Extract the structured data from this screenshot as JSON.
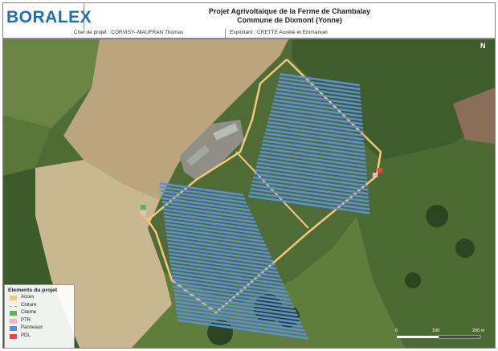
{
  "logo": {
    "text": "BORALEX"
  },
  "title": {
    "line1": "Projet Agrivoltaique de la Ferme de Chambalay",
    "line2": "Commune de Dixmont (Yonne)"
  },
  "info": {
    "chef_projet": "Chef de projet : CORVISY--MAUFRAN Thomas",
    "exploitant": "Exploitant : CRETTE Aurélie et  Emmanuel"
  },
  "legend": {
    "title": "Elements du projet",
    "items": [
      {
        "label": "Acces",
        "color": "#f4c77a",
        "style": "fill"
      },
      {
        "label": "Cloture",
        "color": "#66cc66",
        "style": "dash"
      },
      {
        "label": "Citerne",
        "color": "#59b84a",
        "style": "fill"
      },
      {
        "label": "PTR",
        "color": "#f2b6c6",
        "style": "fill"
      },
      {
        "label": "Panneaux",
        "color": "#5b8fd6",
        "style": "fill"
      },
      {
        "label": "PDL",
        "color": "#e8454d",
        "style": "fill"
      }
    ]
  },
  "north": {
    "symbol": "N"
  },
  "scale": {
    "labels": [
      "0",
      "100",
      "200 m"
    ]
  },
  "colors": {
    "field_light": "#c8b58c",
    "field_tan": "#b3a07a",
    "grass": "#4d6a34",
    "forest": "#2f4a23",
    "crop_green": "#5d7a3a",
    "panel": "#5b8fd6",
    "access": "#f4c77a"
  }
}
